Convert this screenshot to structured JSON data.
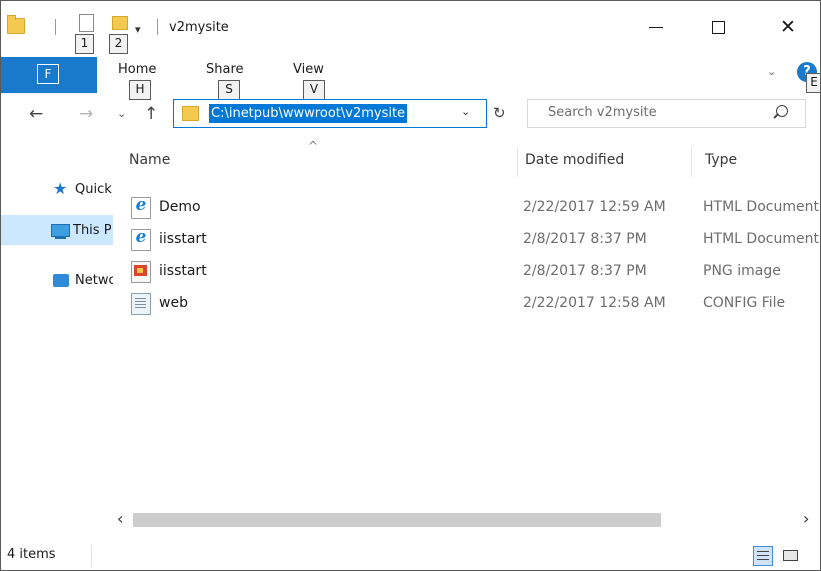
{
  "window": {
    "title": "v2mysite",
    "minimize_label": "",
    "maximize_label": "",
    "close_label": "✕"
  },
  "quick_access": {
    "keytip_1": "1",
    "keytip_2": "2",
    "dropdown_glyph": "▾"
  },
  "ribbon": {
    "file_keytip": "F",
    "tabs": [
      {
        "label": "Home",
        "keytip": "H"
      },
      {
        "label": "Share",
        "keytip": "S"
      },
      {
        "label": "View",
        "keytip": "V"
      }
    ],
    "help_label": "?",
    "help_keytip": "E"
  },
  "navigation": {
    "back_glyph": "←",
    "forward_glyph": "→",
    "recent_glyph": "⌄",
    "up_glyph": "↑",
    "address_path": "C:\\inetpub\\wwwroot\\v2mysite",
    "address_dropdown_glyph": "⌄",
    "refresh_glyph": "↻"
  },
  "search": {
    "placeholder": "Search v2mysite"
  },
  "nav_pane": {
    "items": [
      {
        "label": "Quick access",
        "icon": "star-icon"
      },
      {
        "label": "This PC",
        "icon": "computer-icon"
      },
      {
        "label": "Network",
        "icon": "network-icon"
      }
    ],
    "selected_index": 1
  },
  "file_list": {
    "sort_indicator": "^",
    "columns": {
      "name": "Name",
      "date": "Date modified",
      "type": "Type"
    },
    "rows": [
      {
        "name": "Demo",
        "date": "2/22/2017 12:59 AM",
        "type": "HTML Document",
        "icon": "html-file-icon"
      },
      {
        "name": "iisstart",
        "date": "2/8/2017 8:37 PM",
        "type": "HTML Document",
        "icon": "html-file-icon"
      },
      {
        "name": "iisstart",
        "date": "2/8/2017 8:37 PM",
        "type": "PNG image",
        "icon": "png-file-icon"
      },
      {
        "name": "web",
        "date": "2/22/2017 12:58 AM",
        "type": "CONFIG File",
        "icon": "config-file-icon"
      }
    ]
  },
  "scrollbar": {
    "left_glyph": "‹",
    "right_glyph": "›"
  },
  "status": {
    "item_count": "4 items"
  },
  "colors": {
    "accent": "#1979ca",
    "selection": "#cce8ff",
    "address_highlight": "#0078d7"
  }
}
